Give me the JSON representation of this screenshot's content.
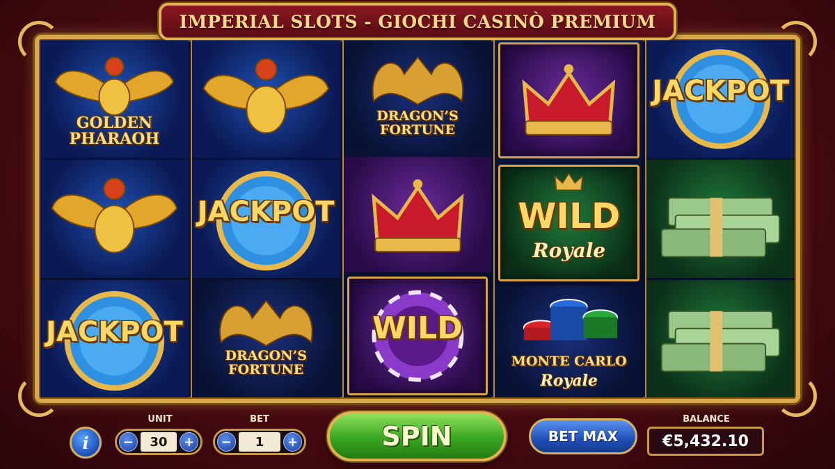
{
  "title": "IMPERIAL SLOTS - GIOCHI CASINÒ PREMIUM",
  "reels": [
    {
      "symbols": [
        {
          "type": "scarab",
          "label_lines": [
            "GOLDEN",
            "PHARAOH"
          ]
        },
        {
          "type": "scarab"
        },
        {
          "type": "jackpot",
          "word": "JACKPOT"
        }
      ]
    },
    {
      "symbols": [
        {
          "type": "scarab"
        },
        {
          "type": "jackpot",
          "word": "JACKPOT"
        },
        {
          "type": "dragon",
          "label_lines": [
            "DRAGON’S",
            "FORTUNE"
          ]
        }
      ]
    },
    {
      "symbols": [
        {
          "type": "dragon",
          "label_lines": [
            "DRAGON’S",
            "FORTUNE"
          ]
        },
        {
          "type": "crown"
        },
        {
          "type": "wild-chip",
          "word": "WILD"
        }
      ]
    },
    {
      "symbols": [
        {
          "type": "crown"
        },
        {
          "type": "wild-royale",
          "word": "WILD",
          "script": "Royale"
        },
        {
          "type": "chips",
          "label_lines": [
            "MONTE CARLO"
          ],
          "script": "Royale"
        }
      ]
    },
    {
      "symbols": [
        {
          "type": "jackpot",
          "word": "JACKPOT"
        },
        {
          "type": "cash"
        },
        {
          "type": "cash"
        }
      ]
    }
  ],
  "controls": {
    "info_icon": "i",
    "unit_label": "UNIT",
    "unit_value": "30",
    "bet_label": "BET",
    "bet_value": "1",
    "minus": "−",
    "plus": "+",
    "spin_label": "SPIN",
    "bet_max_label": "BET MAX",
    "balance_label": "BALANCE",
    "balance_value": "€5,432.10"
  },
  "colors": {
    "gold": "#e2b352",
    "banner_red": "#8a1822",
    "spin_green": "#3aa622",
    "button_blue": "#1f4fb8"
  }
}
